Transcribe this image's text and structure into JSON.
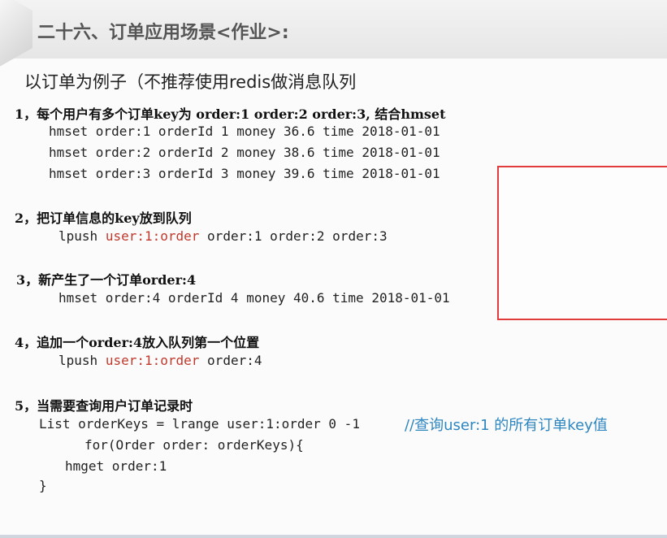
{
  "title": "二十六、订单应用场景<作业>:",
  "subtitle": "以订单为例子（不推荐使用redis做消息队列",
  "sections": [
    {
      "heading": "1，每个用户有多个订单key为 order:1  order:2  order:3, 结合hmset",
      "lines": [
        "hmset order:1 orderId 1 money 36.6 time 2018-01-01",
        "hmset order:2 orderId 2 money 38.6 time 2018-01-01",
        "hmset order:3 orderId 3 money 39.6 time 2018-01-01"
      ]
    },
    {
      "heading": "2，把订单信息的key放到队列",
      "cmd": "lpush",
      "key": "user:1:order",
      "rest": "order:1 order:2 order:3"
    },
    {
      "heading": "3，新产生了一个订单order:4",
      "line": "hmset order:4 orderId 4 money 40.6 time 2018-01-01"
    },
    {
      "heading": "4，追加一个order:4放入队列第一个位置",
      "cmd": "lpush",
      "key": "user:1:order",
      "rest": "order:4"
    },
    {
      "heading": "5，当需要查询用户订单记录时",
      "line1": "List orderKeys = lrange user:1:order 0 -1",
      "comment": "//查询user:1 的所有订单key值",
      "line2": "for(Order order: orderKeys){",
      "line3": "hmget order:1",
      "line4": "}"
    }
  ],
  "colors": {
    "highlight": "#c0392b",
    "comment": "#2e86c1",
    "box_border": "#e23b3b"
  }
}
